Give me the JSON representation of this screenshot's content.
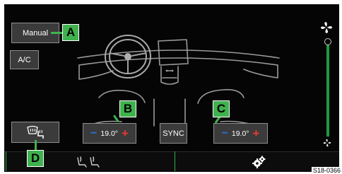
{
  "controls": {
    "mode_label": "Manual",
    "ac_label": "A/C",
    "sync_label": "SYNC"
  },
  "zones": {
    "driver_temp": "19.0°",
    "passenger_temp": "19.0°",
    "minus_symbol": "−",
    "plus_symbol": "+"
  },
  "callouts": {
    "a": "A",
    "b": "B",
    "c": "C",
    "d": "D"
  },
  "fan": {
    "level_percent": 100
  },
  "icons": {
    "fan_top": "fan-icon",
    "fan_bottom": "fan-icon",
    "defrost": "windscreen-defrost-icon",
    "seat_heating": "seat-heating-icon",
    "settings": "gears-icon"
  },
  "accent_color": "#3fb24e",
  "figure_code": "S18-0366"
}
